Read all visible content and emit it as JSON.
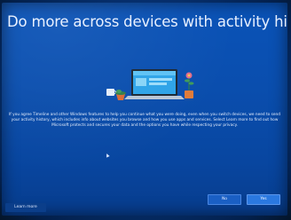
{
  "setup": {
    "title": "Do more across devices with activity history",
    "body": "If you agree Timeline and other Windows features to help you continue what you were doing, even when you switch devices, we need to send your activity history, which includes info about websites you browse and how you use apps and services. Select Learn more to find out how Microsoft protects and secures your data and the options you have while respecting your privacy.",
    "illustration_icon": "laptop-with-plants-icon"
  },
  "footer": {
    "learn_more_label": "Learn more",
    "no_label": "No",
    "yes_label": "Yes"
  },
  "colors": {
    "background": "#0a4eae",
    "primary_button": "#2a78e0",
    "secondary_button": "#1a5fc4"
  }
}
